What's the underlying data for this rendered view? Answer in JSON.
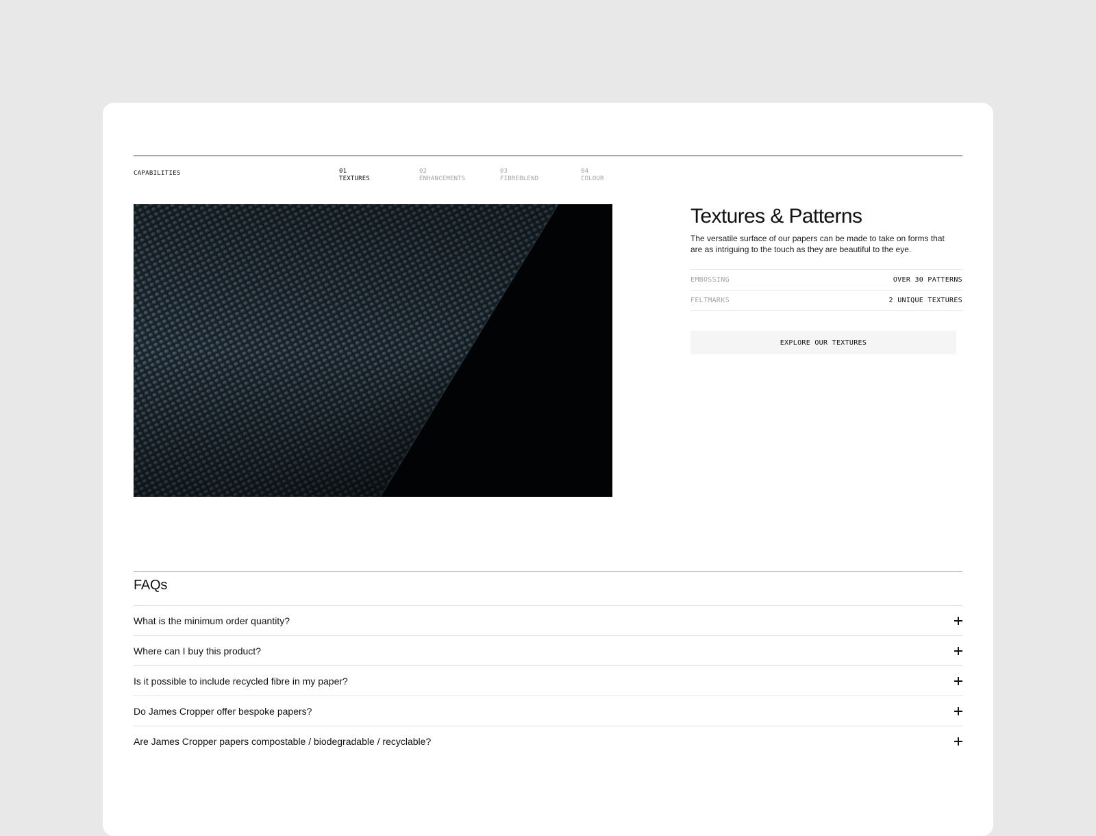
{
  "capabilities": {
    "label": "CAPABILITIES",
    "tabs": [
      {
        "num": "01",
        "label": "TEXTURES",
        "active": true
      },
      {
        "num": "02",
        "label": "ENHANCEMENTS",
        "active": false
      },
      {
        "num": "03",
        "label": "FIBREBLEND",
        "active": false
      },
      {
        "num": "04",
        "label": "COLOUR",
        "active": false
      }
    ],
    "heading": "Textures & Patterns",
    "description": "The versatile surface of our papers can be made to take on forms that are as intriguing to the touch as they are beautiful to the eye.",
    "specs": [
      {
        "key": "EMBOSSING",
        "value": "OVER 30 PATTERNS"
      },
      {
        "key": "FELTMARKS",
        "value": "2 UNIQUE TEXTURES"
      }
    ],
    "cta_label": "EXPLORE OUR TEXTURES"
  },
  "faq": {
    "title": "FAQs",
    "items": [
      {
        "question": "What is the minimum order quantity?"
      },
      {
        "question": "Where can I buy this product?"
      },
      {
        "question": "Is it possible to include recycled fibre in my paper?"
      },
      {
        "question": "Do James Cropper offer bespoke papers?"
      },
      {
        "question": "Are James Cropper papers compostable / biodegradable / recyclable?"
      }
    ],
    "expand_icon": "plus-icon"
  },
  "colors": {
    "page_bg": "#e8e8e8",
    "card_bg": "#ffffff",
    "muted_text": "#a4a4a4",
    "cta_bg": "#f5f5f5"
  }
}
